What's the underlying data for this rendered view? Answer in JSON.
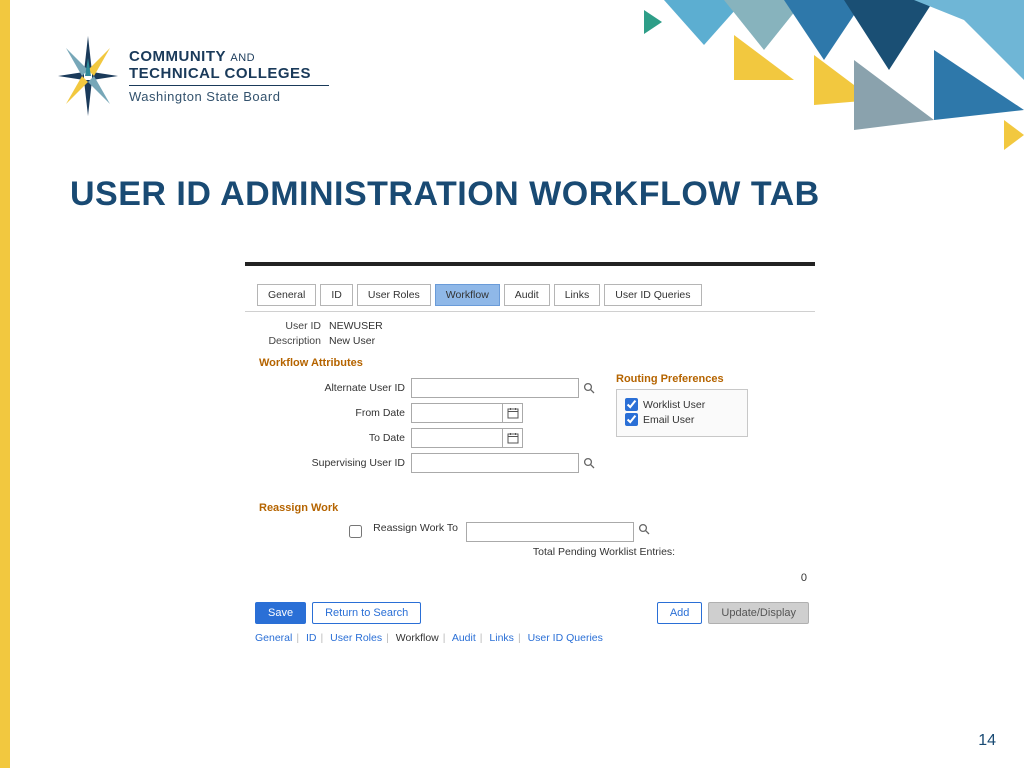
{
  "page": {
    "title": "USER ID ADMINISTRATION WORKFLOW TAB",
    "number": "14"
  },
  "logo": {
    "line1_a": "COMMUNITY",
    "line1_b": "AND",
    "line2": "TECHNICAL COLLEGES",
    "line3": "Washington State Board"
  },
  "tabs": [
    "General",
    "ID",
    "User Roles",
    "Workflow",
    "Audit",
    "Links",
    "User ID Queries"
  ],
  "tabs_selected": "Workflow",
  "meta": {
    "user_id_label": "User ID",
    "user_id_value": "NEWUSER",
    "desc_label": "Description",
    "desc_value": "New User"
  },
  "workflow": {
    "section": "Workflow Attributes",
    "alt_user_label": "Alternate User ID",
    "from_date_label": "From Date",
    "to_date_label": "To Date",
    "sup_user_label": "Supervising User ID"
  },
  "routing": {
    "title": "Routing Preferences",
    "worklist_label": "Worklist User",
    "worklist_checked": true,
    "email_label": "Email User",
    "email_checked": true
  },
  "reassign": {
    "section": "Reassign Work",
    "checkbox_checked": false,
    "to_label": "Reassign Work To",
    "pending_label": "Total Pending Worklist Entries:",
    "pending_value": "0"
  },
  "buttons": {
    "save": "Save",
    "return": "Return to Search",
    "add": "Add",
    "update": "Update/Display"
  },
  "bottom_links": [
    "General",
    "ID",
    "User Roles",
    "Workflow",
    "Audit",
    "Links",
    "User ID Queries"
  ]
}
